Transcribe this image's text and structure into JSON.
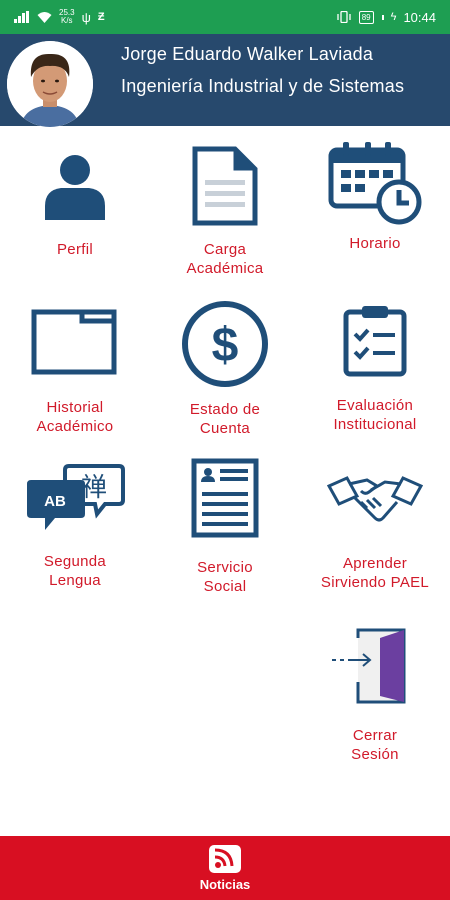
{
  "status_bar": {
    "speed_value": "25.3",
    "speed_unit": "K/s",
    "battery": "89",
    "time": "10:44"
  },
  "header": {
    "name": "Jorge Eduardo Walker Laviada",
    "program": "Ingeniería Industrial y de Sistemas"
  },
  "menu": {
    "perfil": "Perfil",
    "carga": "Carga\nAcadémica",
    "horario": "Horario",
    "historial": "Historial\nAcadémico",
    "estado": "Estado de\nCuenta",
    "evaluacion": "Evaluación\nInstitucional",
    "lengua": "Segunda\nLengua",
    "servicio": "Servicio\nSocial",
    "aprender": "Aprender\nSirviendo PAEL",
    "cerrar": "Cerrar\nSesión"
  },
  "bottom_nav": {
    "news_label": "Noticias"
  },
  "colors": {
    "status_bar": "#1e9e52",
    "header": "#27496d",
    "icon": "#1f4e79",
    "label": "#d11a2a",
    "bottom_bar": "#d80f22"
  }
}
